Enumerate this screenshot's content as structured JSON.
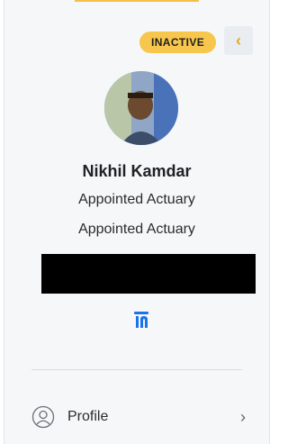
{
  "card": {
    "status_badge": "INACTIVE",
    "collapse_icon": "chevron-left-icon",
    "name": "Nikhil Kamdar",
    "roles": [
      "Appointed Actuary",
      "Appointed Actuary"
    ],
    "social_icon": "linkedin-icon",
    "menu": [
      {
        "label": "Profile",
        "icon": "user-circle-icon",
        "arrow": "chevron-right-icon"
      }
    ]
  },
  "colors": {
    "badge_bg": "#f7c64d",
    "panel_bg": "#f6f7f8",
    "link_blue": "#1a73e8"
  }
}
